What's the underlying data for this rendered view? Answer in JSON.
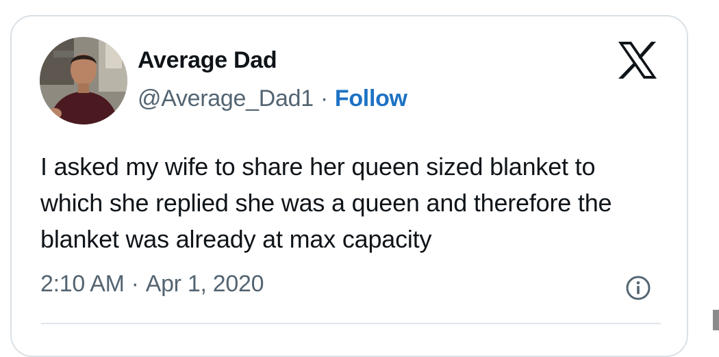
{
  "tweet": {
    "author": {
      "name": "Average Dad",
      "handle": "@Average_Dad1",
      "separator": "·",
      "follow_label": "Follow"
    },
    "platform_icon": "x-logo-icon",
    "text": "I asked my wife to share her queen sized blanket to which she replied she was a queen and therefore the blanket was already at max capacity",
    "time": "2:10 AM",
    "date_separator": "·",
    "date": "Apr 1, 2020",
    "info_icon": "info-icon"
  },
  "colors": {
    "text_primary": "#0f1419",
    "text_secondary": "#536471",
    "link": "#1d72c4",
    "border": "#d9e0e5"
  }
}
